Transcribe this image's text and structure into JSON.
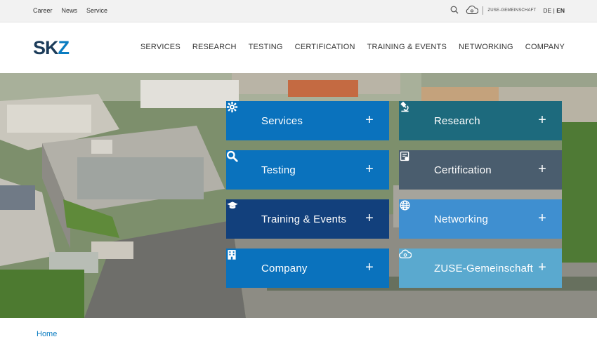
{
  "topbar": {
    "links": [
      "Career",
      "News",
      "Service"
    ],
    "zuse_label": "ZUSE-GEMEINSCHAFT",
    "lang_de": "DE",
    "lang_sep": "|",
    "lang_en": "EN"
  },
  "logo": {
    "text_a": "SK",
    "text_b": "Z"
  },
  "nav": [
    "SERVICES",
    "RESEARCH",
    "TESTING",
    "CERTIFICATION",
    "TRAINING & EVENTS",
    "NETWORKING",
    "COMPANY"
  ],
  "tiles": [
    {
      "label": "Services",
      "icon": "gear-icon",
      "color": "#0a72bd"
    },
    {
      "label": "Research",
      "icon": "microscope-icon",
      "color": "#1d6a7d"
    },
    {
      "label": "Testing",
      "icon": "search-icon",
      "color": "#0a72bd"
    },
    {
      "label": "Certification",
      "icon": "certificate-icon",
      "color": "#4a5d6e"
    },
    {
      "label": "Training & Events",
      "icon": "graduation-cap-icon",
      "color": "#12407c"
    },
    {
      "label": "Networking",
      "icon": "globe-icon",
      "color": "#3f8fd0"
    },
    {
      "label": "Company",
      "icon": "building-icon",
      "color": "#0a72bd"
    },
    {
      "label": "ZUSE-Gemeinschaft",
      "icon": "cloud-icon",
      "color": "#5aa9cf"
    }
  ],
  "plus": "+",
  "breadcrumb": "Home"
}
